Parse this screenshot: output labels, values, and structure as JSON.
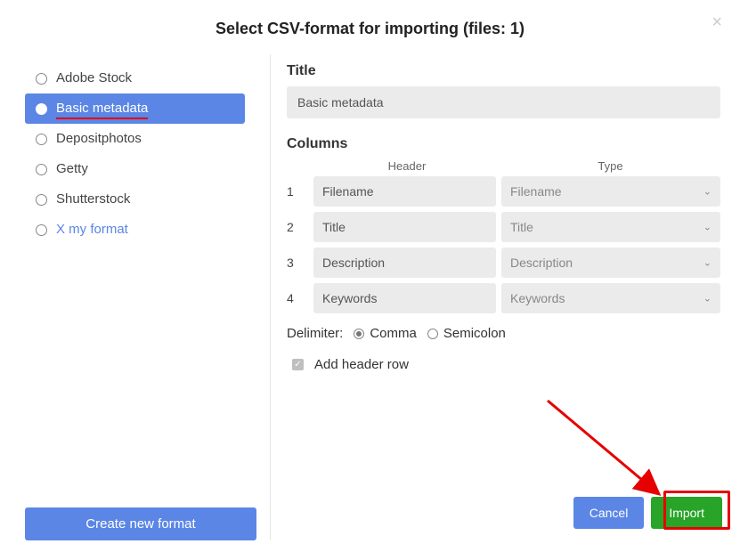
{
  "dialog": {
    "title": "Select CSV-format for importing (files: 1)"
  },
  "formats": [
    {
      "label": "Adobe Stock",
      "selected": false
    },
    {
      "label": "Basic metadata",
      "selected": true
    },
    {
      "label": "Depositphotos",
      "selected": false
    },
    {
      "label": "Getty",
      "selected": false
    },
    {
      "label": "Shutterstock",
      "selected": false
    },
    {
      "label": "X my format",
      "selected": false
    }
  ],
  "create_button": "Create new format",
  "right": {
    "title_label": "Title",
    "title_value": "Basic metadata",
    "columns_label": "Columns",
    "header_col": "Header",
    "type_col": "Type",
    "rows": [
      {
        "n": "1",
        "header": "Filename",
        "type": "Filename"
      },
      {
        "n": "2",
        "header": "Title",
        "type": "Title"
      },
      {
        "n": "3",
        "header": "Description",
        "type": "Description"
      },
      {
        "n": "4",
        "header": "Keywords",
        "type": "Keywords"
      }
    ],
    "delimiter_label": "Delimiter:",
    "delimiter_options": {
      "comma": "Comma",
      "semicolon": "Semicolon"
    },
    "delimiter_selected": "comma",
    "add_header_label": "Add header row",
    "add_header_checked": true
  },
  "buttons": {
    "cancel": "Cancel",
    "import": "Import"
  }
}
